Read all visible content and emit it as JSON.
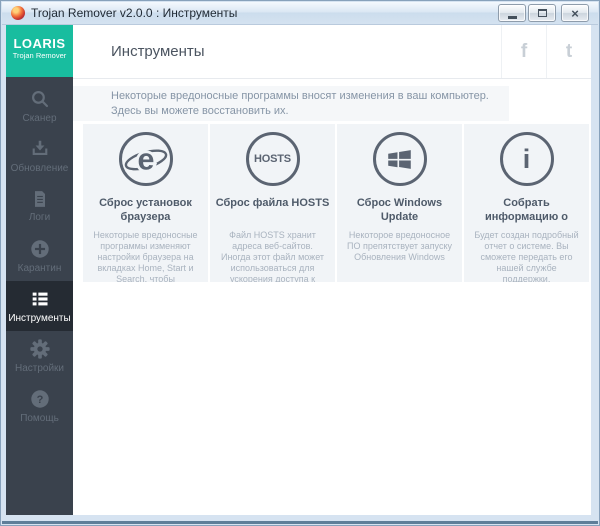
{
  "window": {
    "title": "Trojan Remover v2.0.0 : Инструменты"
  },
  "logo": {
    "name": "LOARIS",
    "subtitle": "Trojan Remover"
  },
  "sidebar": {
    "items": [
      {
        "label": "Сканер",
        "icon": "search-icon",
        "active": false
      },
      {
        "label": "Обновление",
        "icon": "download-icon",
        "active": false
      },
      {
        "label": "Логи",
        "icon": "document-icon",
        "active": false
      },
      {
        "label": "Карантин",
        "icon": "plus-circle-icon",
        "active": false
      },
      {
        "label": "Инструменты",
        "icon": "list-icon",
        "active": true
      },
      {
        "label": "Настройки",
        "icon": "gear-icon",
        "active": false
      },
      {
        "label": "Помощь",
        "icon": "question-icon",
        "active": false
      }
    ]
  },
  "header": {
    "title": "Инструменты",
    "social": [
      {
        "name": "facebook",
        "glyph": "f"
      },
      {
        "name": "twitter",
        "glyph": "t"
      }
    ]
  },
  "infobar": {
    "line1": "Некоторые вредоносные программы вносят изменения в ваш компьютер.",
    "line2": "Здесь вы можете восстановить их."
  },
  "tools": [
    {
      "icon": "ie-icon",
      "icon_text": "e",
      "title": "Сброс установок\nбраузера",
      "description": "Некоторые вредоносные программы изменяют настройки браузера на вкладках Home, Start и Search, чтобы перенаправлять браузер на другие веб-сайты"
    },
    {
      "icon": "hosts-icon",
      "icon_text": "HOSTS",
      "title": "Сброс файла HOSTS",
      "description": "Файл HOSTS хранит адреса веб-сайтов. Иногда этот файл может использоваться для ускорения доступа к сайтам, которые вы часто посещаете"
    },
    {
      "icon": "windows-icon",
      "title": "Сброс Windows\nUpdate",
      "description": "Некоторое вредоносное ПО препятствует запуску Обновления Windows"
    },
    {
      "icon": "info-icon",
      "icon_text": "i",
      "title": "Собрать\nинформацию о",
      "description": "Будет создан подробный отчет о системе. Вы сможете передать его нашей службе поддержки."
    }
  ],
  "colors": {
    "accent_teal": "#18bd9f",
    "sidebar_bg": "#3a424d",
    "sidebar_active_bg": "#252b33",
    "card_bg": "#f1f4f7",
    "icon_gray": "#5b6472",
    "info_text": "#8695a6"
  }
}
